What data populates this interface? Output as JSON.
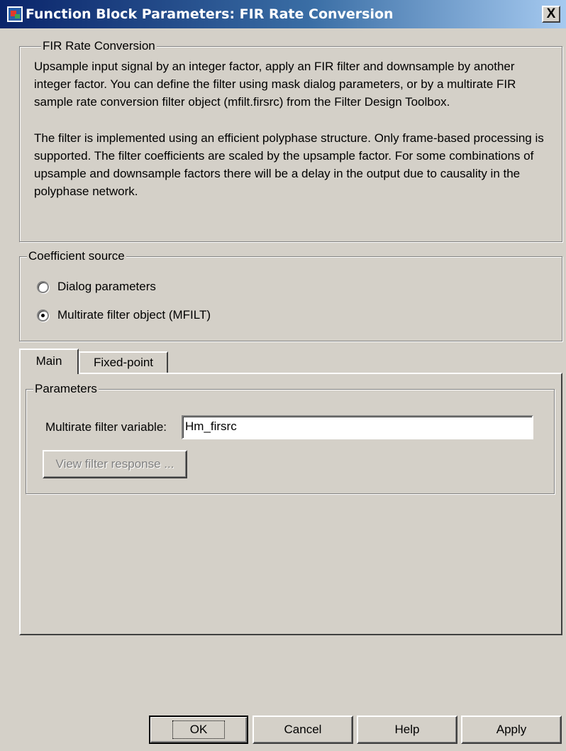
{
  "window": {
    "title": "Function Block Parameters: FIR Rate Conversion",
    "close_label": "X"
  },
  "description_group": {
    "legend": "FIR Rate Conversion",
    "paragraphs": [
      "Upsample input signal by an integer factor, apply an FIR filter and downsample by another integer factor. You can define the filter using mask dialog parameters, or by a multirate FIR sample rate conversion filter object (mfilt.firsrc) from the Filter Design Toolbox.",
      "The filter is implemented using an efficient polyphase structure. Only frame-based processing is supported. The filter coefficients are scaled by the upsample factor. For some combinations of upsample and downsample factors there will be a delay in the output due to causality in the polyphase network."
    ]
  },
  "coefficient_source": {
    "legend": "Coefficient source",
    "options": [
      {
        "label": "Dialog parameters",
        "selected": false
      },
      {
        "label": "Multirate filter object (MFILT)",
        "selected": true
      }
    ]
  },
  "tabs": [
    {
      "label": "Main",
      "active": true
    },
    {
      "label": "Fixed-point",
      "active": false
    }
  ],
  "parameters": {
    "legend": "Parameters",
    "filter_variable_label": "Multirate filter variable:",
    "filter_variable_value": "Hm_firsrc",
    "view_response_label": "View filter response ..."
  },
  "buttons": {
    "ok": "OK",
    "cancel": "Cancel",
    "help": "Help",
    "apply": "Apply"
  }
}
